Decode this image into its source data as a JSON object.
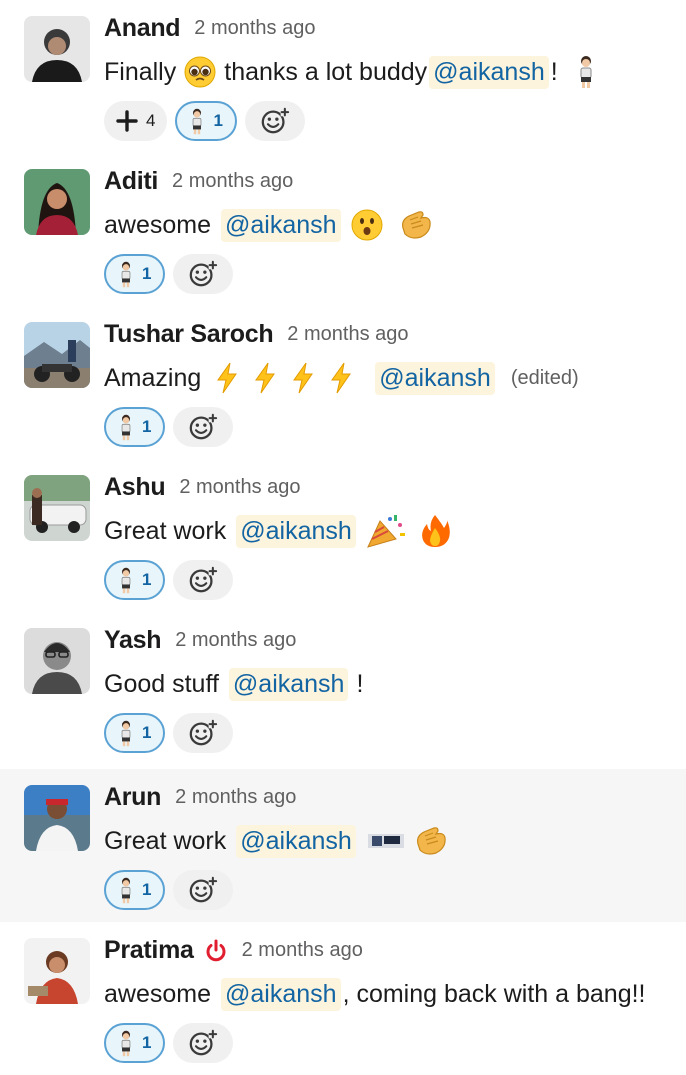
{
  "accent_colors": {
    "mention_bg": "#fdf4dd",
    "mention_text": "#1264a3",
    "active_reaction_border": "#5ba2d4",
    "highlight_row": "#f6f6f6"
  },
  "messages": [
    {
      "name": "Anand",
      "time": "2 months ago",
      "pre": "Finally",
      "mid": "thanks a lot buddy",
      "mention": "@aikansh",
      "post": "!",
      "reactions": {
        "plus_count": "4",
        "person_count": "1"
      }
    },
    {
      "name": "Aditi",
      "time": "2 months ago",
      "pre": "awesome",
      "mention": "@aikansh",
      "reactions": {
        "person_count": "1"
      }
    },
    {
      "name": "Tushar Saroch",
      "time": "2 months ago",
      "pre": "Amazing",
      "mention": "@aikansh",
      "edited": "(edited)",
      "reactions": {
        "person_count": "1"
      }
    },
    {
      "name": "Ashu",
      "time": "2 months ago",
      "pre": "Great work",
      "mention": "@aikansh",
      "reactions": {
        "person_count": "1"
      }
    },
    {
      "name": "Yash",
      "time": "2 months ago",
      "pre": "Good stuff",
      "mention": "@aikansh",
      "post": "!",
      "reactions": {
        "person_count": "1"
      }
    },
    {
      "name": "Arun",
      "time": "2 months ago",
      "pre": "Great work",
      "mention": "@aikansh",
      "reactions": {
        "person_count": "1"
      }
    },
    {
      "name": "Pratima",
      "time": "2 months ago",
      "pre": "awesome",
      "mention": "@aikansh",
      "post": ", coming back with a bang!!",
      "reactions": {
        "person_count": "1"
      }
    }
  ]
}
